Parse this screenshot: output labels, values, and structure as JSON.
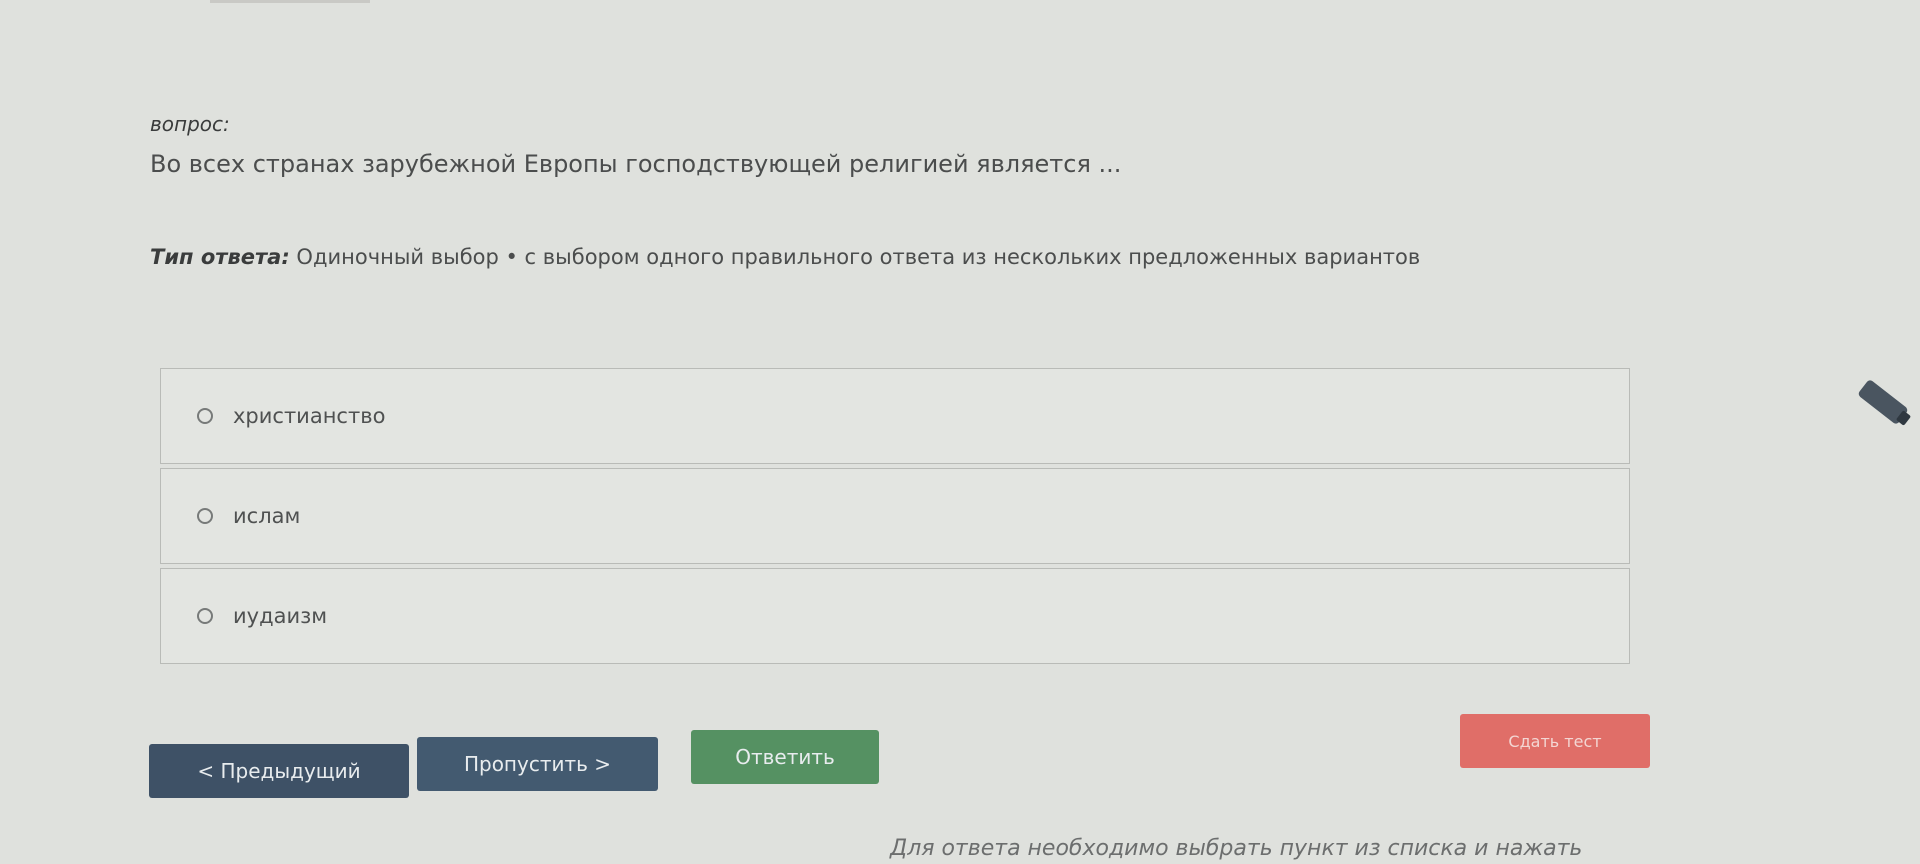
{
  "question": {
    "label": "вопрос:",
    "text": "Во всех странах зарубежной Европы господствующей религией является ..."
  },
  "answer_type": {
    "label": "Тип ответа:",
    "value": "Одиночный выбор • с выбором одного правильного ответа из нескольких предложенных вариантов"
  },
  "options": [
    {
      "label": "христианство"
    },
    {
      "label": "ислам"
    },
    {
      "label": "иудаизм"
    }
  ],
  "buttons": {
    "prev": "< Предыдущий",
    "skip": "Пропустить >",
    "answer": "Ответить",
    "finish": "Сдать тест"
  },
  "hint": "Для ответа необходимо выбрать пункт из списка и нажать",
  "colors": {
    "background": "#dfe1dd",
    "prev_button": "#3e5166",
    "skip_button": "#435a70",
    "answer_button": "#559162",
    "finish_button": "#e06e68"
  },
  "icons": {
    "edge": "pen-icon"
  }
}
